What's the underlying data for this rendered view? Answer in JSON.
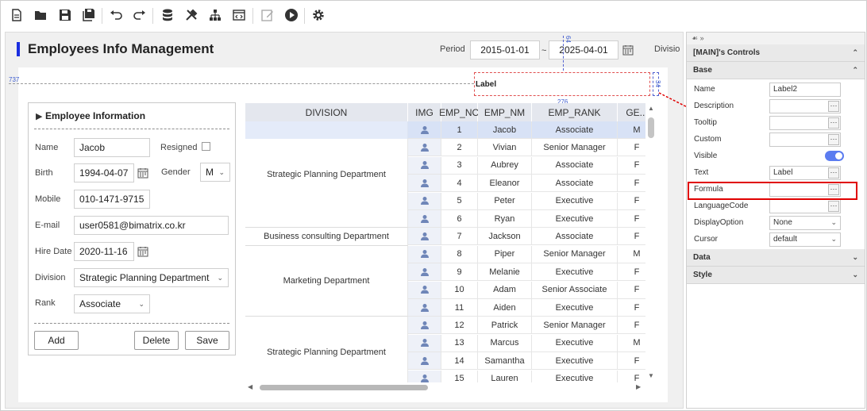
{
  "toolbar": {
    "buttons": [
      "new-file",
      "open-folder",
      "save",
      "save-all",
      "undo",
      "redo",
      "database",
      "tools",
      "hierarchy",
      "code-view",
      "edit",
      "run",
      "settings"
    ]
  },
  "page": {
    "title": "Employees Info Management"
  },
  "filters": {
    "period_label": "Period",
    "start_date": "2015-01-01",
    "range_sep": "~",
    "end_date": "2025-04-01",
    "division_label": "Divisio"
  },
  "guides": {
    "left_value": "737",
    "top_value": "64",
    "width_value": "276",
    "height_value": "34",
    "label_text": "Label"
  },
  "form": {
    "title": "Employee Information",
    "name_label": "Name",
    "name_value": "Jacob",
    "resigned_label": "Resigned",
    "birth_label": "Birth",
    "birth_value": "1994-04-07",
    "gender_label": "Gender",
    "gender_value": "M",
    "mobile_label": "Mobile",
    "mobile_value": "010-1471-9715",
    "email_label": "E-mail",
    "email_value": "user0581@bimatrix.co.kr",
    "hire_label": "Hire Date",
    "hire_value": "2020-11-16",
    "division_label": "Division",
    "division_value": "Strategic Planning Department",
    "rank_label": "Rank",
    "rank_value": "Associate",
    "add_button": "Add",
    "delete_button": "Delete",
    "save_button": "Save"
  },
  "grid": {
    "columns": [
      "DIVISION",
      "IMG",
      "EMP_NO",
      "EMP_NM",
      "EMP_RANK",
      "GE..."
    ],
    "division_groups": [
      {
        "name": "Strategic Planning Department",
        "start": 0,
        "span": 6
      },
      {
        "name": "Business consulting Department",
        "start": 6,
        "span": 1
      },
      {
        "name": "Marketing Department",
        "start": 7,
        "span": 4
      },
      {
        "name": "Strategic Planning Department",
        "start": 11,
        "span": 4
      }
    ],
    "rows": [
      {
        "no": "1",
        "name": "Jacob",
        "rank": "Associate",
        "gender": "M"
      },
      {
        "no": "2",
        "name": "Vivian",
        "rank": "Senior Manager",
        "gender": "F"
      },
      {
        "no": "3",
        "name": "Aubrey",
        "rank": "Associate",
        "gender": "F"
      },
      {
        "no": "4",
        "name": "Eleanor",
        "rank": "Associate",
        "gender": "F"
      },
      {
        "no": "5",
        "name": "Peter",
        "rank": "Executive",
        "gender": "F"
      },
      {
        "no": "6",
        "name": "Ryan",
        "rank": "Executive",
        "gender": "F"
      },
      {
        "no": "7",
        "name": "Jackson",
        "rank": "Associate",
        "gender": "F"
      },
      {
        "no": "8",
        "name": "Piper",
        "rank": "Senior Manager",
        "gender": "M"
      },
      {
        "no": "9",
        "name": "Melanie",
        "rank": "Executive",
        "gender": "F"
      },
      {
        "no": "10",
        "name": "Adam",
        "rank": "Senior Associate",
        "gender": "F"
      },
      {
        "no": "11",
        "name": "Aiden",
        "rank": "Executive",
        "gender": "F"
      },
      {
        "no": "12",
        "name": "Patrick",
        "rank": "Senior Manager",
        "gender": "F"
      },
      {
        "no": "13",
        "name": "Marcus",
        "rank": "Executive",
        "gender": "M"
      },
      {
        "no": "14",
        "name": "Samantha",
        "rank": "Executive",
        "gender": "F"
      },
      {
        "no": "15",
        "name": "Lauren",
        "rank": "Executive",
        "gender": "F"
      }
    ]
  },
  "properties": {
    "title": "[MAIN]'s Controls",
    "sections": {
      "base": "Base",
      "data": "Data",
      "style": "Style"
    },
    "rows": [
      {
        "name": "Name",
        "value": "Label2",
        "kind": "text"
      },
      {
        "name": "Description",
        "value": "",
        "kind": "dots"
      },
      {
        "name": "Tooltip",
        "value": "",
        "kind": "dots"
      },
      {
        "name": "Custom",
        "value": "",
        "kind": "dots"
      },
      {
        "name": "Visible",
        "value": "",
        "kind": "toggle"
      },
      {
        "name": "Text",
        "value": "Label",
        "kind": "dots"
      },
      {
        "name": "Formula",
        "value": "",
        "kind": "dots"
      },
      {
        "name": "LanguageCode",
        "value": "",
        "kind": "dots"
      },
      {
        "name": "DisplayOption",
        "value": "None",
        "kind": "select"
      },
      {
        "name": "Cursor",
        "value": "default",
        "kind": "select"
      }
    ],
    "dots_glyph": "···"
  },
  "colors": {
    "accent": "#1a2ee0",
    "highlight": "#e00000",
    "toggle": "#5b7cf0",
    "selected_row": "#d8e2f6"
  }
}
